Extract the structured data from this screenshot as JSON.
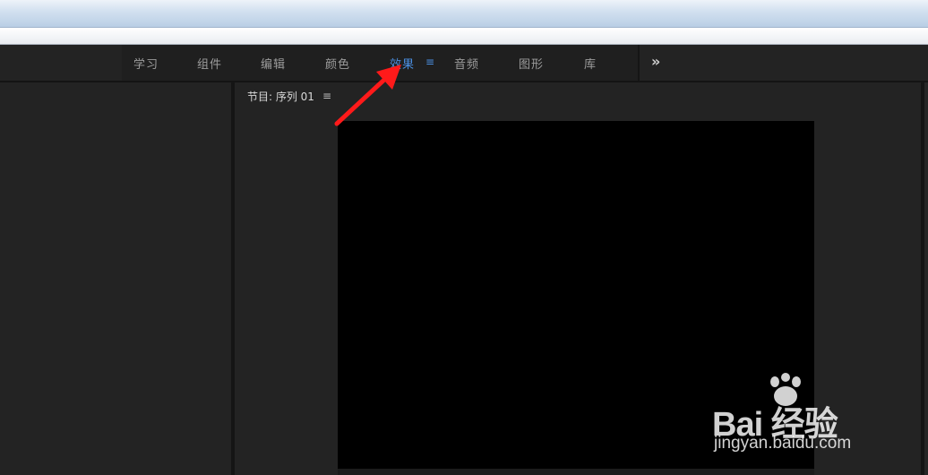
{
  "workspaces": {
    "tabs": [
      {
        "label": "学习",
        "active": false
      },
      {
        "label": "组件",
        "active": false
      },
      {
        "label": "编辑",
        "active": false
      },
      {
        "label": "颜色",
        "active": false
      },
      {
        "label": "效果",
        "active": true
      },
      {
        "label": "音频",
        "active": false
      },
      {
        "label": "图形",
        "active": false
      },
      {
        "label": "库",
        "active": false
      }
    ],
    "menu_icon": "≡",
    "overflow_icon": "»",
    "active_color": "#4a8ee0"
  },
  "program_monitor": {
    "title": "节目: 序列 01",
    "menu_icon": "≡"
  },
  "annotation": {
    "icon": "red-arrow-icon",
    "color": "#ff1a1a"
  },
  "watermark": {
    "brand": "Bai 经验",
    "url": "jingyan.baidu.com"
  }
}
